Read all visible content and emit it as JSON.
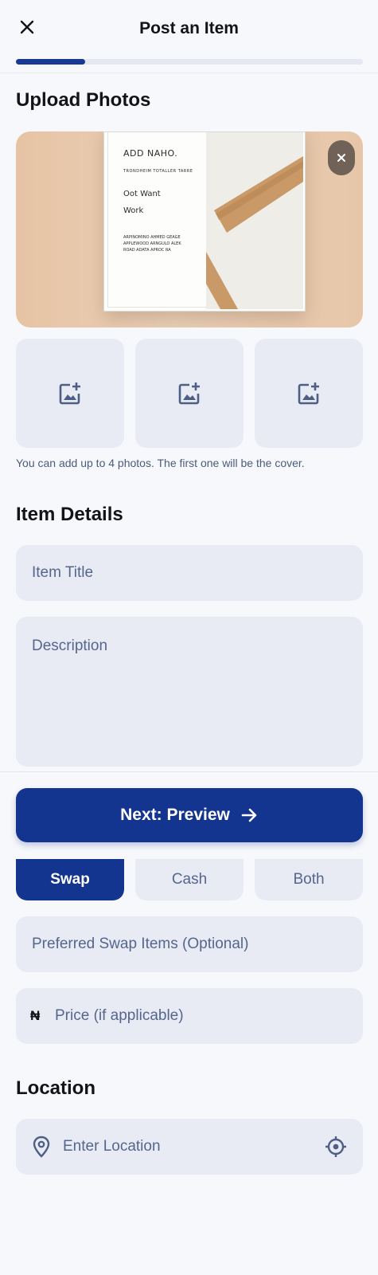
{
  "header": {
    "title": "Post an Item",
    "close_icon": "close-icon",
    "progress": 0.2,
    "accent_color": "#173a94"
  },
  "upload": {
    "section_title": "Upload Photos",
    "cover": {
      "doc_lines": [
        "ADD NAHO.",
        "TRONDHEIM TOTALLER TARRE",
        "Oot Want",
        "Work",
        "ARPINOMINO AHMED GEAGE\nAPPLEWOOD ARNGULO ALEK\nROAD ADATA APROC RA"
      ],
      "remove_icon": "close-icon"
    },
    "thumbs": [
      {
        "icon": "add-photo-icon"
      },
      {
        "icon": "add-photo-icon"
      },
      {
        "icon": "add-photo-icon"
      }
    ],
    "hint": "You can add up to 4 photos. The first one will be the cover."
  },
  "details": {
    "section_title": "Item Details",
    "title_placeholder": "Item Title",
    "description_placeholder": "Description"
  },
  "footer": {
    "next_label": "Next: Preview",
    "next_icon": "arrow-right-icon"
  },
  "trade": {
    "options": [
      "Swap",
      "Cash",
      "Both"
    ],
    "selected": "Swap",
    "preferred_placeholder": "Preferred Swap Items (Optional)",
    "currency_symbol": "₦",
    "price_placeholder": "Price (if applicable)"
  },
  "location": {
    "section_title": "Location",
    "placeholder": "Enter Location",
    "pin_icon": "location-pin-icon",
    "target_icon": "gps-target-icon"
  }
}
